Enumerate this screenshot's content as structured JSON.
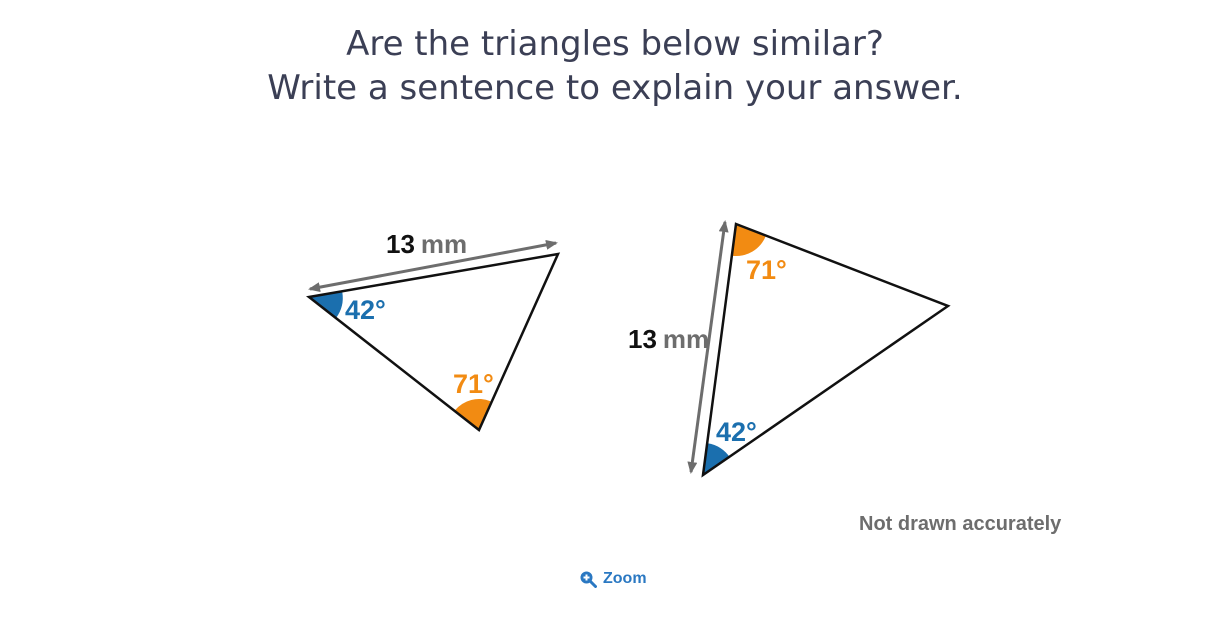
{
  "question": {
    "line1": "Are the triangles below similar?",
    "line2": "Write a sentence to explain your answer."
  },
  "triangle_left": {
    "side_value": "13",
    "side_unit": "mm",
    "angle_blue": "42°",
    "angle_orange": "71°"
  },
  "triangle_right": {
    "side_value": "13",
    "side_unit": "mm",
    "angle_orange": "71°",
    "angle_blue": "42°"
  },
  "note": "Not drawn accurately",
  "zoom": {
    "label": "Zoom",
    "icon": "zoom-in-icon"
  },
  "colors": {
    "text": "#3b3f55",
    "blue": "#1b6fae",
    "orange": "#f28b12",
    "arrow": "#6d6d6d",
    "zoom": "#2a78c2"
  }
}
